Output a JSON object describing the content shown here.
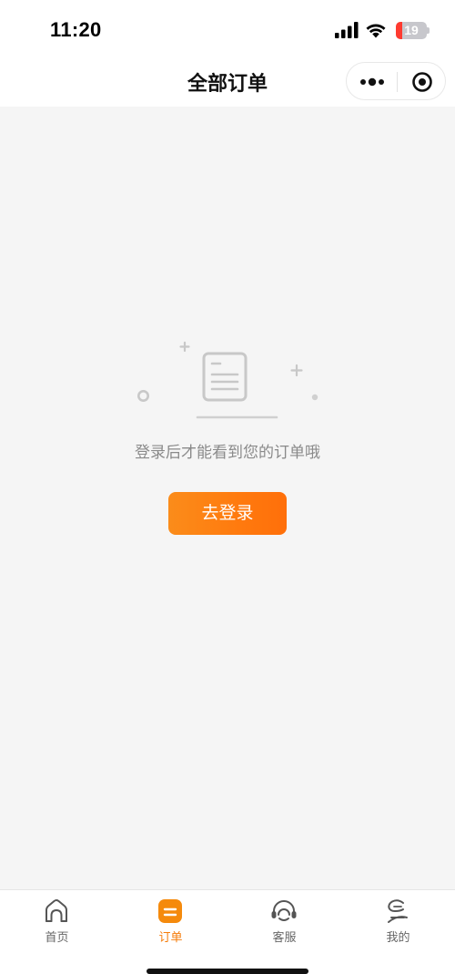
{
  "status_bar": {
    "time": "11:20",
    "battery_level": "19",
    "battery_color": "#ff3b30"
  },
  "nav": {
    "title": "全部订单",
    "more_icon": "more-dots-icon",
    "close_icon": "target-close-icon"
  },
  "empty_state": {
    "message": "登录后才能看到您的订单哦",
    "icon": "document-icon",
    "login_label": "去登录"
  },
  "tab_bar": {
    "items": [
      {
        "label": "首页",
        "icon": "home-icon",
        "active": false
      },
      {
        "label": "订单",
        "icon": "order-icon",
        "active": true
      },
      {
        "label": "客服",
        "icon": "headset-icon",
        "active": false
      },
      {
        "label": "我的",
        "icon": "profile-icon",
        "active": false
      }
    ]
  },
  "colors": {
    "accent": "#ff7a0e",
    "background": "#f5f5f5",
    "text_secondary": "#8a8a8a"
  }
}
